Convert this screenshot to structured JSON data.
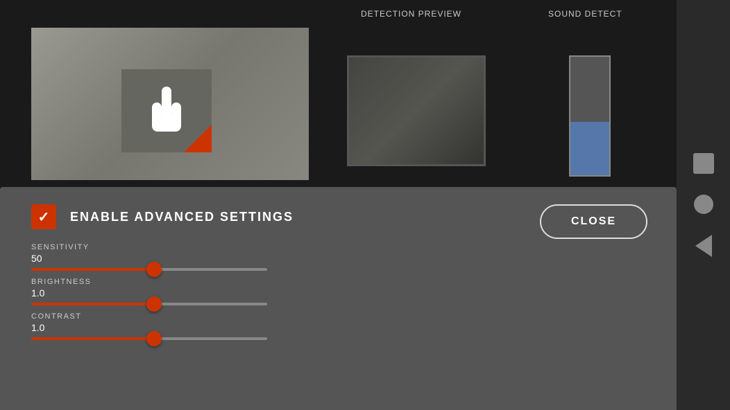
{
  "header": {
    "detection_preview_label": "DETECTION PREVIEW",
    "sound_detect_label": "SOUND DETECT"
  },
  "close_button": {
    "label": "CLOSE"
  },
  "settings": {
    "enable_label": "ENABLE   ADVANCED SETTINGS",
    "sensitivity": {
      "label": "SENSITIVITY",
      "value": "50",
      "percent": 52
    },
    "brightness": {
      "label": "BRIGHTNESS",
      "value": "1.0",
      "percent": 52
    },
    "contrast": {
      "label": "CONTRAST",
      "value": "1.0",
      "percent": 52
    }
  },
  "colors": {
    "accent": "#cc3300",
    "background_dark": "#1a1a1a",
    "panel_bg": "#555555",
    "text_primary": "#ffffff",
    "text_secondary": "#cccccc"
  }
}
